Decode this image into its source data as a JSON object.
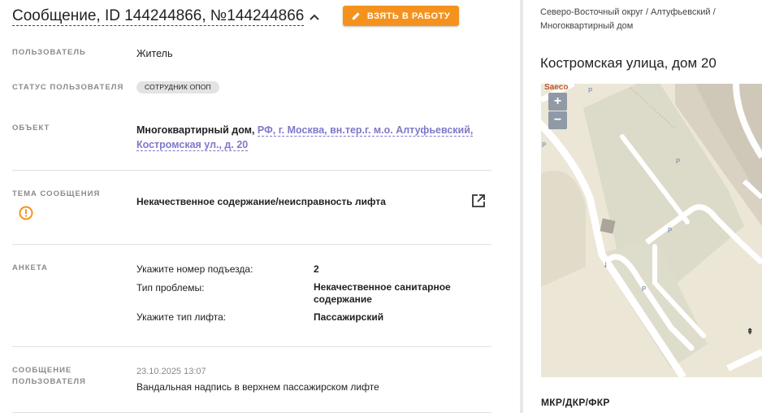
{
  "header": {
    "title": "Сообщение, ID 144244866, №144244866",
    "take_button_label": "ВЗЯТЬ В РАБОТУ"
  },
  "fields": {
    "user_label": "ПОЛЬЗОВАТЕЛЬ",
    "user_value": "Житель",
    "user_status_label": "СТАТУС ПОЛЬЗОВАТЕЛЯ",
    "user_status_badge": "СОТРУДНИК ОПОП",
    "object_label": "ОБЪЕКТ",
    "object_type": "Многоквартирный дом,",
    "object_address_line1": "РФ, г. Москва, вн.тер.г. м.о. Алтуфьевский,",
    "object_address_line2": "Костромская ул., д. 20",
    "topic_label": "ТЕМА СООБЩЕНИЯ",
    "topic_value": "Некачественное содержание/неисправность лифта",
    "survey_label": "АНКЕТА",
    "survey_rows": [
      {
        "question": "Укажите номер подъезда:",
        "answer": "2"
      },
      {
        "question": "Тип проблемы:",
        "answer": "Некачественное санитарное содержание"
      },
      {
        "question": "Укажите тип лифта:",
        "answer": "Пассажирский"
      }
    ],
    "message_label_line1": "СООБЩЕНИЕ",
    "message_label_line2": "ПОЛЬЗОВАТЕЛЯ",
    "message_date": "23.10.2025 13:07",
    "message_text": "Вандальная надпись в верхнем пассажирском лифте"
  },
  "side": {
    "breadcrumb": "Северо-Восточный округ / Алтуфьевский / Многоквартирный дом",
    "address_title": "Костромская улица, дом 20",
    "map": {
      "zoom_in": "+",
      "zoom_out": "−",
      "place_label": "Saeco",
      "parking_marker": "P"
    },
    "footer_label": "МКР/ДКР/ФКР"
  },
  "colors": {
    "accent_button": "#f5921e",
    "link": "#7f78c9",
    "warning": "#f5921e"
  },
  "icons": [
    "pencil-icon",
    "chevron-up-icon",
    "warning-circle-icon",
    "external-link-icon"
  ]
}
